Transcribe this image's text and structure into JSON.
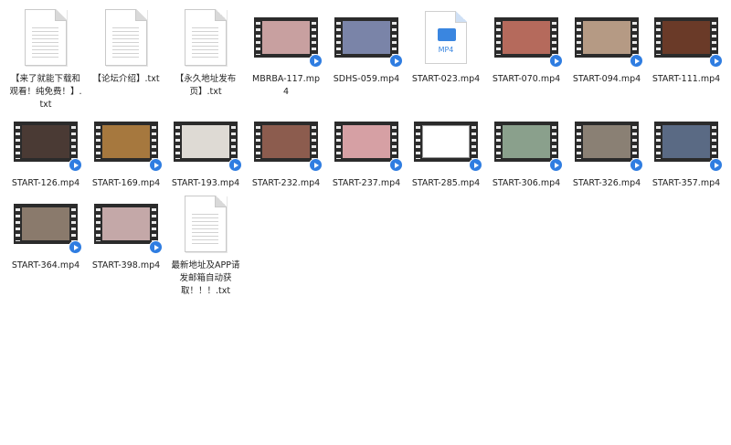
{
  "files": [
    {
      "name": "【来了就能下载和观看！纯免费！】.txt",
      "type": "txt"
    },
    {
      "name": "【论坛介绍】.txt",
      "type": "txt"
    },
    {
      "name": "【永久地址发布页】.txt",
      "type": "txt"
    },
    {
      "name": "MBRBA-117.mp4",
      "type": "video",
      "color": "#c8a0a0"
    },
    {
      "name": "SDHS-059.mp4",
      "type": "video",
      "color": "#7a84a8"
    },
    {
      "name": "START-023.mp4",
      "type": "mp4",
      "icon_label": "MP4"
    },
    {
      "name": "START-070.mp4",
      "type": "video",
      "color": "#b56a5c"
    },
    {
      "name": "START-094.mp4",
      "type": "video",
      "color": "#b59a84"
    },
    {
      "name": "START-111.mp4",
      "type": "video",
      "color": "#6a3a28"
    },
    {
      "name": "START-126.mp4",
      "type": "video",
      "color": "#4a3a34"
    },
    {
      "name": "START-169.mp4",
      "type": "video",
      "color": "#a6783e"
    },
    {
      "name": "START-193.mp4",
      "type": "video",
      "color": "#dedad4"
    },
    {
      "name": "START-232.mp4",
      "type": "video",
      "color": "#8c5c4e"
    },
    {
      "name": "START-237.mp4",
      "type": "video",
      "color": "#d6a0a4"
    },
    {
      "name": "START-285.mp4",
      "type": "video",
      "color": "#ffffff"
    },
    {
      "name": "START-306.mp4",
      "type": "video",
      "color": "#8aa08c"
    },
    {
      "name": "START-326.mp4",
      "type": "video",
      "color": "#8a8074"
    },
    {
      "name": "START-357.mp4",
      "type": "video",
      "color": "#5a6a84"
    },
    {
      "name": "START-364.mp4",
      "type": "video",
      "color": "#8a7a6c"
    },
    {
      "name": "START-398.mp4",
      "type": "video",
      "color": "#c4a8a8"
    },
    {
      "name": "最新地址及APP请发邮箱自动获取！！！.txt",
      "type": "txt"
    }
  ]
}
